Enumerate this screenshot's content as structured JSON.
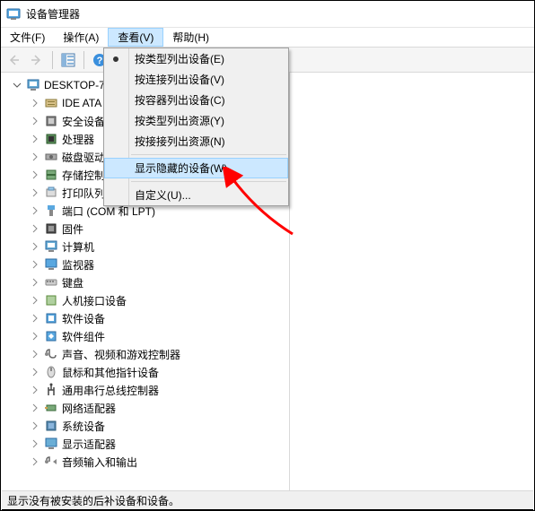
{
  "window": {
    "title": "设备管理器"
  },
  "menus": {
    "file": "文件(F)",
    "action": "操作(A)",
    "view": "查看(V)",
    "help": "帮助(H)"
  },
  "dropdown": {
    "devices_by_type": "按类型列出设备(E)",
    "devices_by_connection": "按连接列出设备(V)",
    "devices_by_container": "按容器列出设备(C)",
    "resources_by_type": "按类型列出资源(Y)",
    "resources_by_connection": "按接接列出资源(N)",
    "show_hidden": "显示隐藏的设备(W)",
    "customize": "自定义(U)..."
  },
  "tree": {
    "root": "DESKTOP-7",
    "items": [
      {
        "label": "IDE ATA"
      },
      {
        "label": "安全设备"
      },
      {
        "label": "处理器"
      },
      {
        "label": "磁盘驱动"
      },
      {
        "label": "存储控制"
      },
      {
        "label": "打印队列"
      },
      {
        "label": "端口 (COM 和 LPT)"
      },
      {
        "label": "固件"
      },
      {
        "label": "计算机"
      },
      {
        "label": "监视器"
      },
      {
        "label": "键盘"
      },
      {
        "label": "人机接口设备"
      },
      {
        "label": "软件设备"
      },
      {
        "label": "软件组件"
      },
      {
        "label": "声音、视频和游戏控制器"
      },
      {
        "label": "鼠标和其他指针设备"
      },
      {
        "label": "通用串行总线控制器"
      },
      {
        "label": "网络适配器"
      },
      {
        "label": "系统设备"
      },
      {
        "label": "显示适配器"
      },
      {
        "label": "音频输入和输出"
      }
    ]
  },
  "statusbar": "显示没有被安装的后补设备和设备。",
  "icons": {
    "ide": "ide-icon",
    "security": "chip-icon",
    "cpu": "cpu-icon",
    "disk": "disk-icon",
    "storage": "storage-icon",
    "printer": "printer-icon",
    "port": "port-icon",
    "firmware": "firmware-icon",
    "computer": "computer-icon",
    "monitor": "monitor-icon",
    "keyboard": "keyboard-icon",
    "hid": "hid-icon",
    "software": "software-icon",
    "component": "component-icon",
    "sound": "sound-icon",
    "mouse": "mouse-icon",
    "usb": "usb-icon",
    "network": "network-icon",
    "system": "system-icon",
    "display": "display-icon",
    "audio": "audio-icon"
  }
}
